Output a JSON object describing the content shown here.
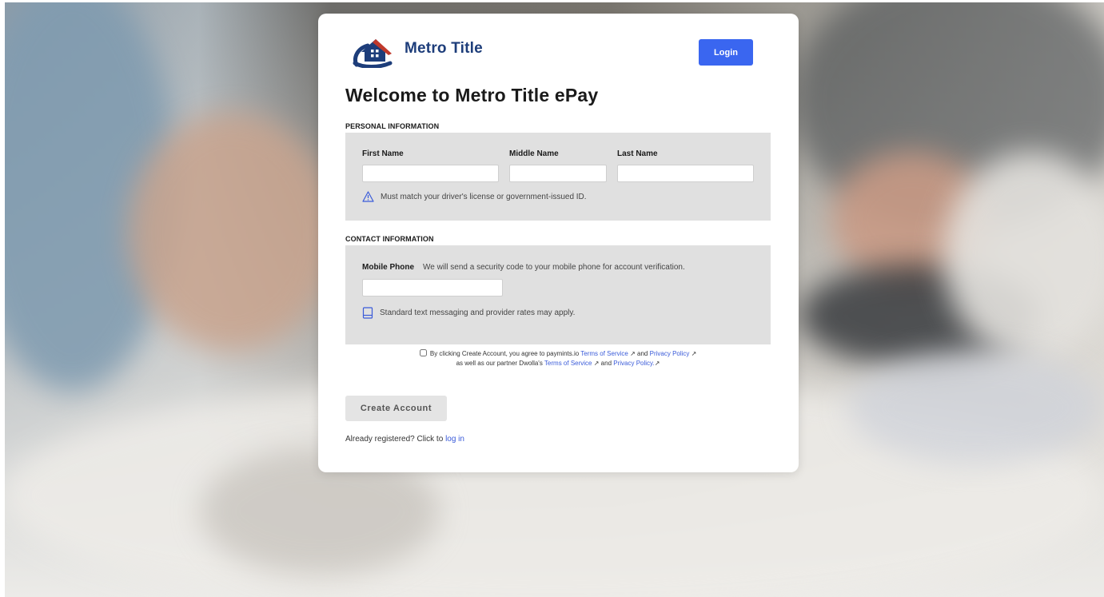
{
  "brand": {
    "name": "Metro Title",
    "primary_color": "#1d3d7a",
    "accent_color": "#c0392b"
  },
  "header": {
    "login_label": "Login",
    "login_color": "#3a66f0"
  },
  "page": {
    "title": "Welcome to Metro Title ePay"
  },
  "personal": {
    "section_title": "PERSONAL INFORMATION",
    "first_name_label": "First Name",
    "middle_name_label": "Middle Name",
    "last_name_label": "Last Name",
    "first_name_value": "",
    "middle_name_value": "",
    "last_name_value": "",
    "warning_icon": "warning-triangle-icon",
    "warning_text": "Must match your driver's license or government-issued ID."
  },
  "contact": {
    "section_title": "CONTACT INFORMATION",
    "mobile_label": "Mobile Phone",
    "mobile_hint": "We will send a security code to your mobile phone for account verification.",
    "mobile_value": "",
    "rates_icon": "mobile-phone-icon",
    "rates_text": "Standard text messaging and provider rates may apply."
  },
  "consent": {
    "checked": false,
    "part1": "By clicking Create Account, you agree to paymints.io",
    "tos1": "Terms of Service",
    "and1": "and",
    "privacy1": "Privacy Policy",
    "part2": "as well as our partner Dwolla's",
    "tos2": "Terms of Service",
    "and2": "and",
    "privacy2": "Privacy Policy.",
    "external_icon": "external-link-icon"
  },
  "actions": {
    "create_label": "Create Account",
    "already_text": "Already registered? Click to",
    "login_link": "log in"
  }
}
